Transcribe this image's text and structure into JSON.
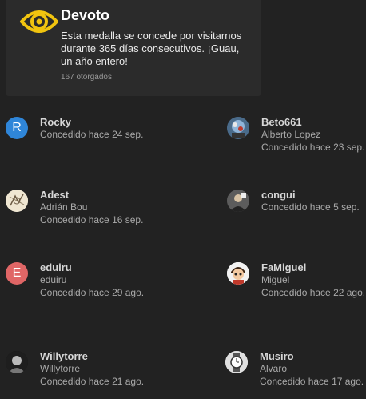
{
  "badge": {
    "icon": "eye-icon",
    "icon_color": "#f1c40f",
    "title": "Devoto",
    "description": "Esta medalla se concede por visitarnos durante 365 días consecutivos. ¡Guau, un año entero!",
    "granted_count": "167 otorgados"
  },
  "users": [
    {
      "username": "Rocky",
      "avatar_letter": "R",
      "avatar_color": "#2f86d9",
      "granted": "Concedido hace 24 sep."
    },
    {
      "username": "Beto661",
      "full_name": "Alberto Lopez",
      "avatar_icon": "photo-avatar-icon",
      "granted": "Concedido hace 23 sep."
    },
    {
      "username": "Adest",
      "full_name": "Adrián Bou",
      "avatar_icon": "sketch-avatar-icon",
      "granted": "Concedido hace 16 sep."
    },
    {
      "username": "congui",
      "avatar_icon": "photo-avatar-icon",
      "granted": "Concedido hace 5 sep."
    },
    {
      "username": "eduiru",
      "full_name": "eduiru",
      "avatar_letter": "E",
      "avatar_color": "#e06666",
      "granted": "Concedido hace 29 ago."
    },
    {
      "username": "FaMiguel",
      "full_name": "Miguel",
      "avatar_icon": "cartoon-avatar-icon",
      "granted": "Concedido hace 22 ago."
    },
    {
      "username": "Willytorre",
      "full_name": "Willytorre",
      "avatar_icon": "photo-avatar-icon",
      "granted": "Concedido hace 21 ago."
    },
    {
      "username": "Musiro",
      "full_name": "Alvaro",
      "avatar_icon": "watch-avatar-icon",
      "granted": "Concedido hace 17 ago."
    }
  ]
}
